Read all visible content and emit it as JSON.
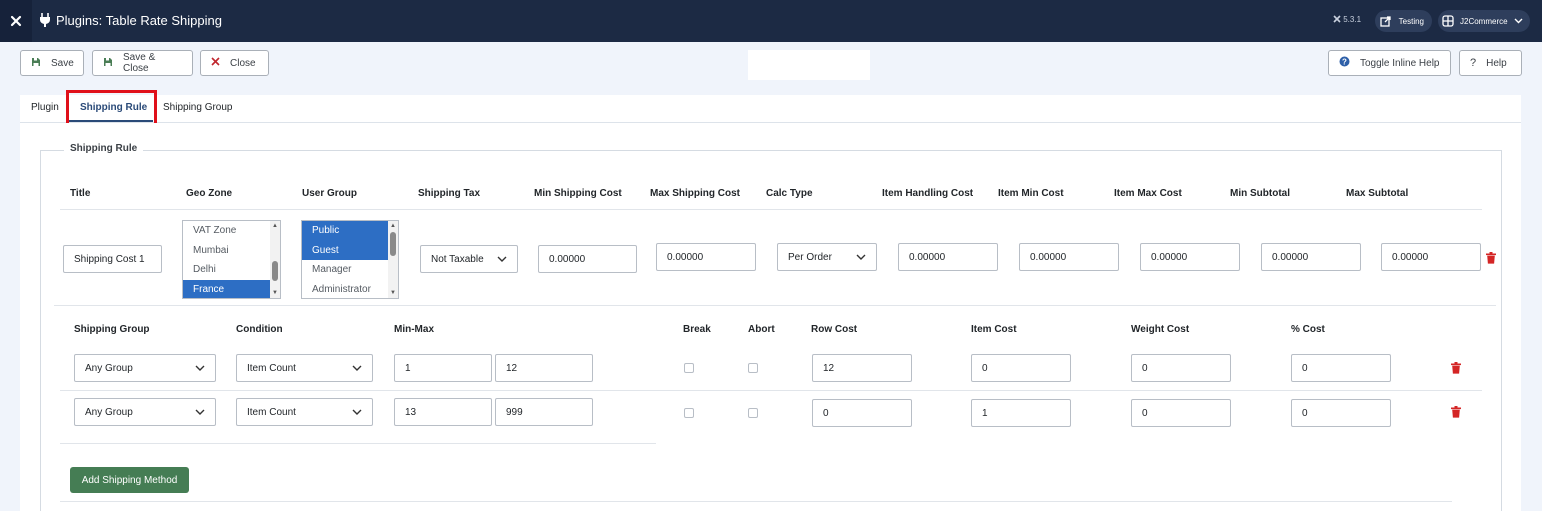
{
  "header": {
    "title": "Plugins: Table Rate Shipping",
    "version": "5.3.1",
    "site_label": "Testing",
    "user_label": "J2Commerce"
  },
  "toolbar": {
    "save": "Save",
    "save_close": "Save & Close",
    "close": "Close",
    "toggle_help": "Toggle Inline Help",
    "help": "Help"
  },
  "tabs": [
    "Plugin",
    "Shipping Rule",
    "Shipping Group"
  ],
  "fieldset_legend": "Shipping Rule",
  "rule_headers": {
    "title": "Title",
    "geo_zone": "Geo Zone",
    "user_group": "User Group",
    "shipping_tax": "Shipping Tax",
    "min_cost": "Min Shipping Cost",
    "max_cost": "Max Shipping Cost",
    "calc_type": "Calc Type",
    "item_handling": "Item Handling Cost",
    "item_min": "Item Min Cost",
    "item_max": "Item Max Cost",
    "min_subtotal": "Min Subtotal",
    "max_subtotal": "Max Subtotal"
  },
  "rule": {
    "title": "Shipping Cost 1",
    "geo_zones": [
      "VAT Zone",
      "Mumbai",
      "Delhi",
      "France"
    ],
    "user_groups": [
      "Public",
      "Guest",
      "Manager",
      "Administrator"
    ],
    "shipping_tax": "Not Taxable",
    "min_cost": "0.00000",
    "max_cost": "0.00000",
    "calc_type": "Per Order",
    "item_handling": "0.00000",
    "item_min": "0.00000",
    "item_max": "0.00000",
    "min_subtotal": "0.00000",
    "max_subtotal": "0.00000"
  },
  "method_headers": {
    "group": "Shipping Group",
    "condition": "Condition",
    "min_max": "Min-Max",
    "break": "Break",
    "abort": "Abort",
    "row_cost": "Row Cost",
    "item_cost": "Item Cost",
    "weight_cost": "Weight Cost",
    "pct_cost": "% Cost"
  },
  "methods": [
    {
      "group": "Any Group",
      "condition": "Item Count",
      "min": "1",
      "max": "12",
      "row_cost": "12",
      "item_cost": "0",
      "weight_cost": "0",
      "pct_cost": "0"
    },
    {
      "group": "Any Group",
      "condition": "Item Count",
      "min": "13",
      "max": "999",
      "row_cost": "0",
      "item_cost": "1",
      "weight_cost": "0",
      "pct_cost": "0"
    }
  ],
  "add_button": "Add Shipping Method"
}
